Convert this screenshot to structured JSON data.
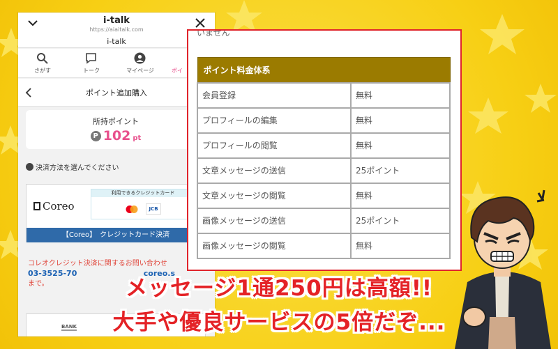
{
  "phone": {
    "app_title": "i-talk",
    "url": "https://aiaitalk.com",
    "subtitle": "i-talk",
    "nav": [
      {
        "label": "さがす",
        "icon": "search-icon"
      },
      {
        "label": "トーク",
        "icon": "chat-icon"
      },
      {
        "label": "マイページ",
        "icon": "user-icon"
      },
      {
        "label": "ポイ",
        "icon": "points-icon"
      }
    ],
    "page_title": "ポイント追加購入",
    "points_label": "所持ポイント",
    "points_coin": "P",
    "points_value": "102",
    "points_unit": "pt",
    "pay_heading": "決済方法を選んでください",
    "coreo_logo": "Coreo",
    "cc_title": "利用できるクレジットカード",
    "jcb": "JCB",
    "coreo_button": "【Coreo】　クレジットカード決済",
    "contact_line1": "コレオクレジット決済に関するお問い合わせ",
    "contact_tel": "03-3525-70",
    "contact_tel_tail": "coreo.s",
    "contact_line3": "まで。",
    "bank_label": "BANK"
  },
  "panel": {
    "cut_text": "いません",
    "table_header": "ポイント料金体系",
    "rows": [
      {
        "item": "会員登録",
        "price": "無料"
      },
      {
        "item": "プロフィールの編集",
        "price": "無料"
      },
      {
        "item": "プロフィールの閲覧",
        "price": "無料"
      },
      {
        "item": "文章メッセージの送信",
        "price": "25ポイント"
      },
      {
        "item": "文章メッセージの閲覧",
        "price": "無料"
      },
      {
        "item": "画像メッセージの送信",
        "price": "25ポイント"
      },
      {
        "item": "画像メッセージの閲覧",
        "price": "無料"
      }
    ]
  },
  "caption": {
    "line1": "メッセージ1通250円は高額!!",
    "line2": "大手や優良サービスの5倍だぞ..."
  },
  "colors": {
    "background": "#f7d21c",
    "accent_pink": "#e8508c",
    "table_header": "#9b7b00",
    "caption_red": "#e42226",
    "coreo_blue": "#2f6aa9"
  }
}
